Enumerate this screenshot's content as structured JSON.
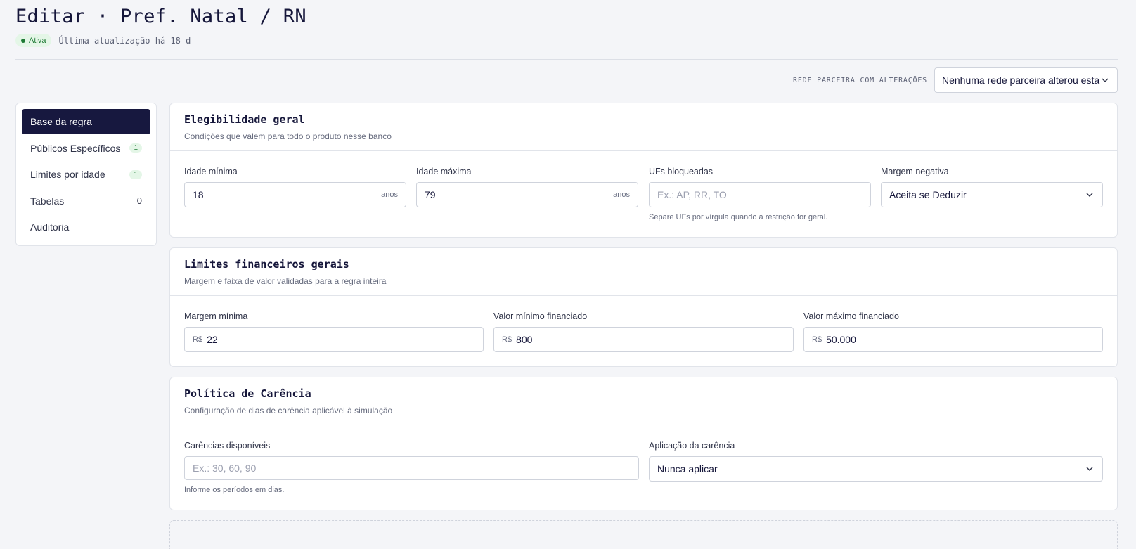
{
  "header": {
    "title": "Editar · Pref. Natal / RN",
    "status_badge": "Ativa",
    "updated": "Última atualização há 18 d"
  },
  "partner": {
    "label": "REDE PARCEIRA COM ALTERAÇÕES",
    "value": "Nenhuma rede parceira alterou esta"
  },
  "sidebar": {
    "items": [
      {
        "label": "Base da regra",
        "count": ""
      },
      {
        "label": "Públicos Específicos",
        "count": "1"
      },
      {
        "label": "Limites por idade",
        "count": "1"
      },
      {
        "label": "Tabelas",
        "count": "0"
      },
      {
        "label": "Auditoria",
        "count": ""
      }
    ]
  },
  "elegibilidade": {
    "title": "Elegibilidade geral",
    "subtitle": "Condições que valem para todo o produto nesse banco",
    "idade_min": {
      "label": "Idade mínima",
      "value": "18",
      "suffix": "anos"
    },
    "idade_max": {
      "label": "Idade máxima",
      "value": "79",
      "suffix": "anos"
    },
    "ufs": {
      "label": "UFs bloqueadas",
      "placeholder": "Ex.: AP, RR, TO",
      "hint": "Separe UFs por vírgula quando a restrição for geral."
    },
    "margem_negativa": {
      "label": "Margem negativa",
      "value": "Aceita se Deduzir"
    }
  },
  "limites": {
    "title": "Limites financeiros gerais",
    "subtitle": "Margem e faixa de valor validadas para a regra inteira",
    "currency": "R$",
    "margem_min": {
      "label": "Margem mínima",
      "value": "22"
    },
    "valor_min": {
      "label": "Valor mínimo financiado",
      "value": "800"
    },
    "valor_max": {
      "label": "Valor máximo financiado",
      "value": "50.000"
    }
  },
  "carencia": {
    "title": "Política de Carência",
    "subtitle": "Configuração de dias de carência aplicável à simulação",
    "disponiveis": {
      "label": "Carências disponíveis",
      "placeholder": "Ex.: 30, 60, 90",
      "hint": "Informe os períodos em dias."
    },
    "aplicacao": {
      "label": "Aplicação da carência",
      "value": "Nunca aplicar"
    }
  }
}
